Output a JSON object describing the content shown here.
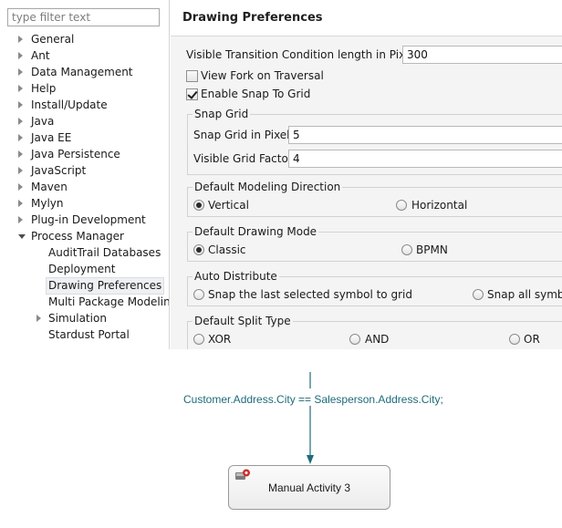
{
  "filter": {
    "placeholder": "type filter text"
  },
  "tree": {
    "items": [
      {
        "label": "General",
        "state": "closed",
        "depth": 0
      },
      {
        "label": "Ant",
        "state": "closed",
        "depth": 0
      },
      {
        "label": "Data Management",
        "state": "closed",
        "depth": 0
      },
      {
        "label": "Help",
        "state": "closed",
        "depth": 0
      },
      {
        "label": "Install/Update",
        "state": "closed",
        "depth": 0
      },
      {
        "label": "Java",
        "state": "closed",
        "depth": 0
      },
      {
        "label": "Java EE",
        "state": "closed",
        "depth": 0
      },
      {
        "label": "Java Persistence",
        "state": "closed",
        "depth": 0
      },
      {
        "label": "JavaScript",
        "state": "closed",
        "depth": 0
      },
      {
        "label": "Maven",
        "state": "closed",
        "depth": 0
      },
      {
        "label": "Mylyn",
        "state": "closed",
        "depth": 0
      },
      {
        "label": "Plug-in Development",
        "state": "closed",
        "depth": 0
      },
      {
        "label": "Process Manager",
        "state": "open",
        "depth": 0
      },
      {
        "label": "AuditTrail Databases",
        "state": "leaf",
        "depth": 1
      },
      {
        "label": "Deployment",
        "state": "leaf",
        "depth": 1
      },
      {
        "label": "Drawing Preferences",
        "state": "leaf",
        "depth": 1,
        "selected": true
      },
      {
        "label": "Multi Package Modelin",
        "state": "leaf",
        "depth": 1
      },
      {
        "label": "Simulation",
        "state": "closed",
        "depth": 1
      },
      {
        "label": "Stardust Portal",
        "state": "leaf",
        "depth": 1
      }
    ]
  },
  "page": {
    "title": "Drawing Preferences",
    "transition_label": "Visible Transition Condition length in Pixel",
    "transition_value": "300",
    "view_fork_label": "View Fork on Traversal",
    "view_fork_checked": false,
    "snap_label": "Enable Snap To Grid",
    "snap_checked": true,
    "snap_grid": {
      "title": "Snap Grid",
      "pixel_label": "Snap Grid in Pixel",
      "pixel_value": "5",
      "factor_label": "Visible Grid Factor",
      "factor_value": "4"
    },
    "direction": {
      "title": "Default Modeling Direction",
      "options": [
        "Vertical",
        "Horizontal"
      ],
      "selected": "Vertical"
    },
    "drawing_mode": {
      "title": "Default Drawing Mode",
      "options": [
        "Classic",
        "BPMN"
      ],
      "selected": "Classic"
    },
    "auto_distribute": {
      "title": "Auto Distribute",
      "options": [
        "Snap the last selected symbol to grid",
        "Snap all symb"
      ]
    },
    "split_type": {
      "title": "Default Split Type",
      "options": [
        "XOR",
        "AND",
        "OR"
      ]
    }
  },
  "diagram": {
    "condition": "Customer.Address.City == Salesperson.Address.City;",
    "activity_label": "Manual Activity 3",
    "colors": {
      "connector": "#1e6b7a",
      "condition_text": "#1e6b7a"
    }
  }
}
